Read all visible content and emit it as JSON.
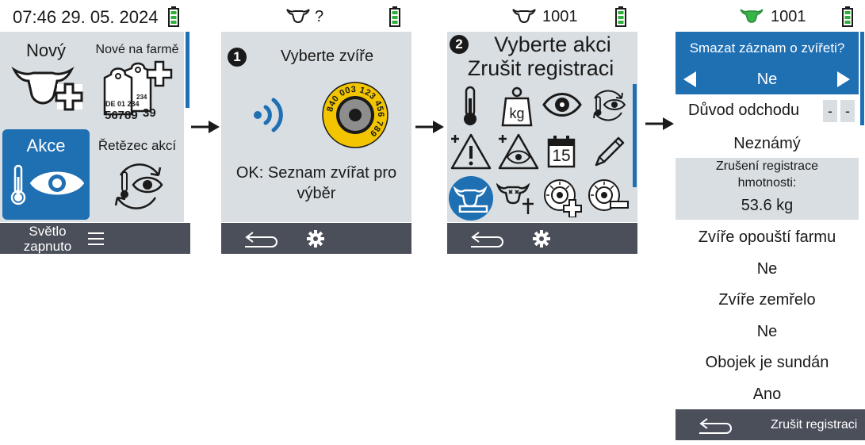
{
  "screen1": {
    "time_date": "07:46 29. 05. 2024",
    "tiles": [
      {
        "label": "Nový",
        "icon": "cow-plus-icon"
      },
      {
        "label": "Nové na farmě",
        "icon": "ear-tags-plus-icon",
        "tag1": "DE 01 234",
        "tag2": "56789",
        "tag3": "234",
        "tag4": "39"
      },
      {
        "label": "Akce",
        "icon": "thermometer-eye-icon"
      },
      {
        "label": "Řetězec akcí",
        "icon": "thermometer-eye-cycle-icon"
      }
    ],
    "footer_light_line1": "Světlo",
    "footer_light_line2": "zapnuto",
    "menu_icon": "hamburger-icon"
  },
  "screen2": {
    "animal_id": "?",
    "step": "1",
    "prompt": "Vyberte zvíře",
    "tag_number": "840 003 123 456 789",
    "hint": "OK: Seznam zvířat pro výběr",
    "icons": [
      "rfid-waves-icon",
      "ear-tag-button-icon",
      "back-icon",
      "gear-icon"
    ]
  },
  "screen3": {
    "animal_id": "1001",
    "step": "2",
    "title_line1": "Vyberte akci",
    "title_line2": "Zrušit registraci",
    "kg_label": "kg",
    "calendar_day": "15",
    "action_icons": [
      "thermometer-icon",
      "weight-kg-icon",
      "eye-icon",
      "thermometer-cycle-icon",
      "warning-plus-icon",
      "eye-warning-plus-icon",
      "calendar-icon",
      "pencil-icon",
      "cow-deregister-icon",
      "dead-cow-icon",
      "tag-plus-icon",
      "tag-minus-icon"
    ]
  },
  "screen4": {
    "animal_id": "1001",
    "header_question": "Smazat záznam o zvířeti?",
    "header_value": "Ne",
    "reason_label": "Důvod odchodu",
    "reason_dashes": [
      "-",
      "-"
    ],
    "reason_value": "Neznámý",
    "weight_label": "Zrušení registrace hmotnosti:",
    "weight_value": "53.6 kg",
    "leaves_label": "Zvíře opouští farmu",
    "leaves_value": "Ne",
    "died_label": "Zvíře zemřelo",
    "died_value": "Ne",
    "collar_label": "Obojek je sundán",
    "collar_value": "Ano",
    "footer_action": "Zrušit registraci"
  },
  "colors": {
    "panel": "#d9dee2",
    "footer": "#4b4f5a",
    "accent_blue": "#1f6fb3",
    "battery_green": "#2fae3b",
    "cow_green": "#38b449",
    "tag_yellow": "#f2c500"
  }
}
